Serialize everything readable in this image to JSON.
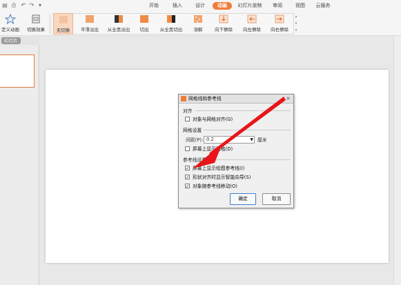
{
  "colors": {
    "accent": "#f07c3a",
    "arrow": "#e8151a",
    "ok_border": "#3c7fd0"
  },
  "quick_access": {
    "icons": [
      "save-icon",
      "print-icon",
      "undo-icon",
      "redo-icon",
      "customize-icon"
    ]
  },
  "tabs": [
    {
      "label": "开始",
      "active": false
    },
    {
      "label": "插入",
      "active": false
    },
    {
      "label": "设计",
      "active": false
    },
    {
      "label": "动画",
      "active": true
    },
    {
      "label": "幻灯片放映",
      "active": false
    },
    {
      "label": "审阅",
      "active": false
    },
    {
      "label": "视图",
      "active": false
    },
    {
      "label": "云服务",
      "active": false
    }
  ],
  "ribbon": {
    "custom_anim": "定义动画",
    "switch_effect": "切换效果",
    "transitions": [
      "无切换",
      "平滑淡出",
      "从全黑淡出",
      "切出",
      "从全黑切出",
      "溶解",
      "向下擦除",
      "向左擦除",
      "向右擦除"
    ]
  },
  "left_panel": {
    "tab": "幻灯片"
  },
  "dialog": {
    "title": "网格线和参考线",
    "close": "×",
    "align_section": "对齐",
    "snap_to_grid": {
      "label": "对象与网格对齐(G)",
      "checked": false
    },
    "grid_section": "网格设置",
    "spacing_label": "间距(P):",
    "spacing_value": "0.2",
    "unit": "厘米",
    "show_grid": {
      "label": "屏幕上显示网格(D)",
      "checked": false
    },
    "guides_section": "参考线设置",
    "show_drawing_guides": {
      "label": "屏幕上显示绘图参考线(I)",
      "checked": true
    },
    "smart_guides": {
      "label": "形状对齐时显示智能向导(S)",
      "checked": true
    },
    "move_with_guides": {
      "label": "对象随参考线移动(O)",
      "checked": true
    },
    "ok": "确定",
    "cancel": "取消"
  }
}
